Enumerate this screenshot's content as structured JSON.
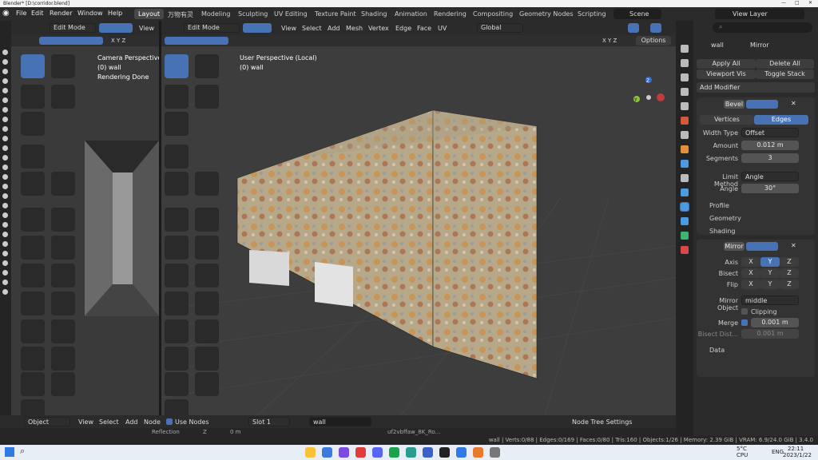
{
  "window": {
    "title": "Blender* [D:\\corridor.blend]"
  },
  "menu": [
    "File",
    "Edit",
    "Render",
    "Window",
    "Help"
  ],
  "workspaces": [
    "Layout",
    "万物有灵",
    "Modeling",
    "Sculpting",
    "UV Editing",
    "Texture Paint",
    "Shading",
    "Animation",
    "Rendering",
    "Compositing",
    "Geometry Nodes",
    "Scripting"
  ],
  "scene": {
    "label": "Scene",
    "view_layer": "View Layer"
  },
  "left_view": {
    "mode": "Edit Mode",
    "view": "View",
    "persp": "Camera Perspective",
    "obj": "(0) wall",
    "render": "Rendering Done",
    "axes": "X Y Z"
  },
  "right_view": {
    "mode": "Edit Mode",
    "menus": [
      "View",
      "Select",
      "Add",
      "Mesh",
      "Vertex",
      "Edge",
      "Face",
      "UV"
    ],
    "orient": "Global",
    "persp": "User Perspective (Local)",
    "obj": "(0) wall",
    "options": "Options",
    "axes": "X Y Z"
  },
  "props": {
    "search": "",
    "obj": "wall",
    "mod": "Mirror",
    "apply_all": "Apply All",
    "delete_all": "Delete All",
    "viewport_vis": "Viewport Vis",
    "toggle_stack": "Toggle Stack",
    "add_modifier": "Add Modifier",
    "bevel": {
      "name": "Bevel",
      "tabs": [
        "Vertices",
        "Edges"
      ],
      "width_type_l": "Width Type",
      "width_type": "Offset",
      "amount_l": "Amount",
      "amount": "0.012 m",
      "segments_l": "Segments",
      "segments": "3",
      "limit_l": "Limit Method",
      "limit": "Angle",
      "angle_l": "Angle",
      "angle": "30°",
      "profile": "Profile",
      "geometry": "Geometry",
      "shading": "Shading"
    },
    "mirror": {
      "name": "Mirror",
      "axis_l": "Axis",
      "bisect_l": "Bisect",
      "flip_l": "Flip",
      "x": "X",
      "y": "Y",
      "z": "Z",
      "mirror_obj_l": "Mirror Object",
      "mirror_obj": "middle",
      "clipping": "Clipping",
      "merge_l": "Merge",
      "merge": "0.001 m",
      "bisect_dist_l": "Bisect Dist...",
      "bisect_dist": "0.001 m",
      "data": "Data"
    }
  },
  "bottom": {
    "object": "Object",
    "view": "View",
    "select": "Select",
    "add": "Add",
    "node": "Node",
    "use_nodes": "Use Nodes",
    "slot": "Slot 1",
    "mat": "wall",
    "tex": "uf2vbffaw_8K_Ro...",
    "reflection": "Reflection",
    "z": "Z",
    "zval": "0 m",
    "node_tree": "Node Tree Settings"
  },
  "status": "wall | Verts:0/88 | Edges:0/169 | Faces:0/80 | Tris:160 | Objects:1/26 | Memory: 2.39 GiB | VRAM: 6.9/24.0 GiB | 3.4.0",
  "taskbar": {
    "weather1": "5°C",
    "weather2": "CPU",
    "lang": "ENG",
    "time": "22:11",
    "date": "2023/1/22"
  },
  "colors": {
    "accent": "#4772b3",
    "bg": "#1d1d1d",
    "panel": "#303030"
  }
}
